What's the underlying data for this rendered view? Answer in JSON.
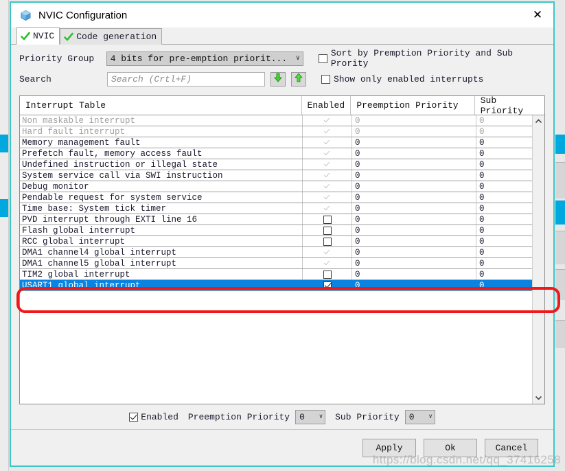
{
  "window": {
    "title": "NVIC Configuration",
    "icon": "cube-icon",
    "close_label": "✕",
    "border_color": "#3bc6c6"
  },
  "tabs": [
    {
      "label": "NVIC",
      "icon": "green-check-icon",
      "active": true
    },
    {
      "label": "Code generation",
      "icon": "green-check-icon",
      "active": false
    }
  ],
  "toolbar": {
    "priority_group_label": "Priority Group",
    "priority_group_value": "4 bits for pre-emption priorit...",
    "priority_group_chevron": "∨",
    "sort_checkbox_label": "Sort by Premption Priority and Sub Prority",
    "sort_checkbox_checked": false,
    "search_label": "Search",
    "search_placeholder": "Search (Crtl+F)",
    "search_value": "",
    "find_next_icon": "green-down-arrow-icon",
    "find_prev_icon": "green-up-arrow-icon",
    "show_enabled_label": "Show only enabled interrupts",
    "show_enabled_checked": false
  },
  "table": {
    "columns": [
      "Interrupt Table",
      "Enabled",
      "Preemption Priority",
      "Sub Priority"
    ],
    "rows": [
      {
        "name": "Non maskable interrupt",
        "enabled_state": "dim-checked",
        "preemption": "0",
        "sub": "0",
        "dim": true,
        "selected": false
      },
      {
        "name": "Hard fault interrupt",
        "enabled_state": "dim-checked",
        "preemption": "0",
        "sub": "0",
        "dim": true,
        "selected": false
      },
      {
        "name": "Memory management fault",
        "enabled_state": "dim-checked",
        "preemption": "0",
        "sub": "0",
        "dim": false,
        "selected": false
      },
      {
        "name": "Prefetch fault, memory access fault",
        "enabled_state": "dim-checked",
        "preemption": "0",
        "sub": "0",
        "dim": false,
        "selected": false
      },
      {
        "name": "Undefined instruction or illegal state",
        "enabled_state": "dim-checked",
        "preemption": "0",
        "sub": "0",
        "dim": false,
        "selected": false
      },
      {
        "name": "System service call via SWI instruction",
        "enabled_state": "dim-checked",
        "preemption": "0",
        "sub": "0",
        "dim": false,
        "selected": false
      },
      {
        "name": "Debug monitor",
        "enabled_state": "dim-checked",
        "preemption": "0",
        "sub": "0",
        "dim": false,
        "selected": false
      },
      {
        "name": "Pendable request for system service",
        "enabled_state": "dim-checked",
        "preemption": "0",
        "sub": "0",
        "dim": false,
        "selected": false
      },
      {
        "name": "Time base: System tick timer",
        "enabled_state": "dim-checked",
        "preemption": "0",
        "sub": "0",
        "dim": false,
        "selected": false
      },
      {
        "name": "PVD interrupt through EXTI line 16",
        "enabled_state": "unchecked",
        "preemption": "0",
        "sub": "0",
        "dim": false,
        "selected": false
      },
      {
        "name": "Flash global interrupt",
        "enabled_state": "unchecked",
        "preemption": "0",
        "sub": "0",
        "dim": false,
        "selected": false
      },
      {
        "name": "RCC global interrupt",
        "enabled_state": "unchecked",
        "preemption": "0",
        "sub": "0",
        "dim": false,
        "selected": false
      },
      {
        "name": "DMA1 channel4 global interrupt",
        "enabled_state": "dim-checked",
        "preemption": "0",
        "sub": "0",
        "dim": false,
        "selected": false
      },
      {
        "name": "DMA1 channel5 global interrupt",
        "enabled_state": "dim-checked",
        "preemption": "0",
        "sub": "0",
        "dim": false,
        "selected": false
      },
      {
        "name": "TIM2 global interrupt",
        "enabled_state": "unchecked",
        "preemption": "0",
        "sub": "0",
        "dim": false,
        "selected": false
      },
      {
        "name": "USART1 global interrupt",
        "enabled_state": "checked",
        "preemption": "0",
        "sub": "0",
        "dim": false,
        "selected": true
      }
    ],
    "scroll_up_icon": "chevron-up-icon",
    "scroll_down_icon": "chevron-down-icon"
  },
  "bottom_controls": {
    "enabled_label": "Enabled",
    "enabled_checked": true,
    "preemption_label": "Preemption Priority",
    "preemption_value": "0",
    "sub_label": "Sub Priority",
    "sub_value": "0",
    "chevron": "∨"
  },
  "footer": {
    "apply_label": "Apply",
    "ok_label": "Ok",
    "cancel_label": "Cancel"
  },
  "annotation": {
    "color": "#f01818",
    "target_row": "USART1 global interrupt"
  },
  "watermark": "https://blog.csdn.net/qq_37416258"
}
